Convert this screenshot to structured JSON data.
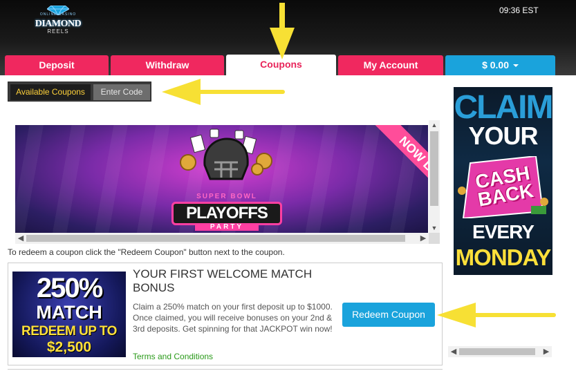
{
  "header": {
    "logo": {
      "top_line": "ONLINE CASINO",
      "name": "DIAMOND",
      "sub": "REELS"
    },
    "clock": "09:36 EST"
  },
  "tabs": [
    {
      "label": "Deposit"
    },
    {
      "label": "Withdraw"
    },
    {
      "label": "Coupons"
    },
    {
      "label": "My Account"
    },
    {
      "label": "$ 0.00"
    }
  ],
  "active_tab": "Coupons",
  "subtabs": {
    "available": "Available Coupons",
    "enter": "Enter Code"
  },
  "banner": {
    "ribbon": "NOW LIVE",
    "small_title": "SUPER BOWL",
    "big_title": "PLAYOFFS",
    "party": "PARTY"
  },
  "instruction": "To redeem a coupon click the \"Redeem Coupon\" button next to the coupon.",
  "coupon": {
    "image": {
      "pct": "250%",
      "match": "MATCH",
      "redeem": "REDEEM UP TO",
      "amount": "$2,500"
    },
    "title": "YOUR FIRST WELCOME MATCH BONUS",
    "description": "Claim a 250% match on your first deposit up to $1000. Once claimed, you will receive bonuses on your 2nd & 3rd deposits. Get spinning for that JACKPOT win now!",
    "terms": "Terms and Conditions",
    "redeem_button": "Redeem Coupon"
  },
  "ad": {
    "claim": "CLAIM",
    "your": "YOUR",
    "cash": "CASH",
    "back": "BACK",
    "every": "EVERY",
    "monday": "MONDAY"
  },
  "colors": {
    "tab_pink": "#f0285f",
    "accent_blue": "#1aa3dc",
    "annotation_yellow": "#f7e034",
    "terms_green": "#2a9a1a"
  },
  "icons": {
    "arrow_up": "▲",
    "arrow_down": "▼",
    "arrow_left": "◀",
    "arrow_right": "▶"
  }
}
